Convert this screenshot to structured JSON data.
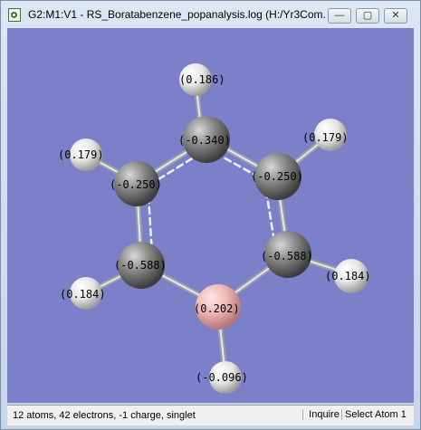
{
  "window": {
    "title": "G2:M1:V1 - RS_Boratabenzene_popanalysis.log (H:/Yr3Com...",
    "minimize_glyph": "—",
    "maximize_glyph": "▢",
    "close_glyph": "✕"
  },
  "viewer": {
    "background_color": "#7c80c9",
    "atoms": [
      {
        "element": "H",
        "charge": "(0.186)"
      },
      {
        "element": "C",
        "charge": "(-0.340)"
      },
      {
        "element": "H",
        "charge": "(0.179)"
      },
      {
        "element": "H",
        "charge": "(0.179)"
      },
      {
        "element": "C",
        "charge": "(-0.250)"
      },
      {
        "element": "C",
        "charge": "(-0.250)"
      },
      {
        "element": "C",
        "charge": "(-0.588)"
      },
      {
        "element": "C",
        "charge": "(-0.588)"
      },
      {
        "element": "H",
        "charge": "(0.184)"
      },
      {
        "element": "H",
        "charge": "(0.184)"
      },
      {
        "element": "B",
        "charge": "(0.202)"
      },
      {
        "element": "H",
        "charge": "(-0.096)"
      }
    ]
  },
  "statusbar": {
    "info": "12 atoms, 42 electrons, -1 charge, singlet",
    "mode": "Inquire",
    "action": "Select Atom 1"
  }
}
